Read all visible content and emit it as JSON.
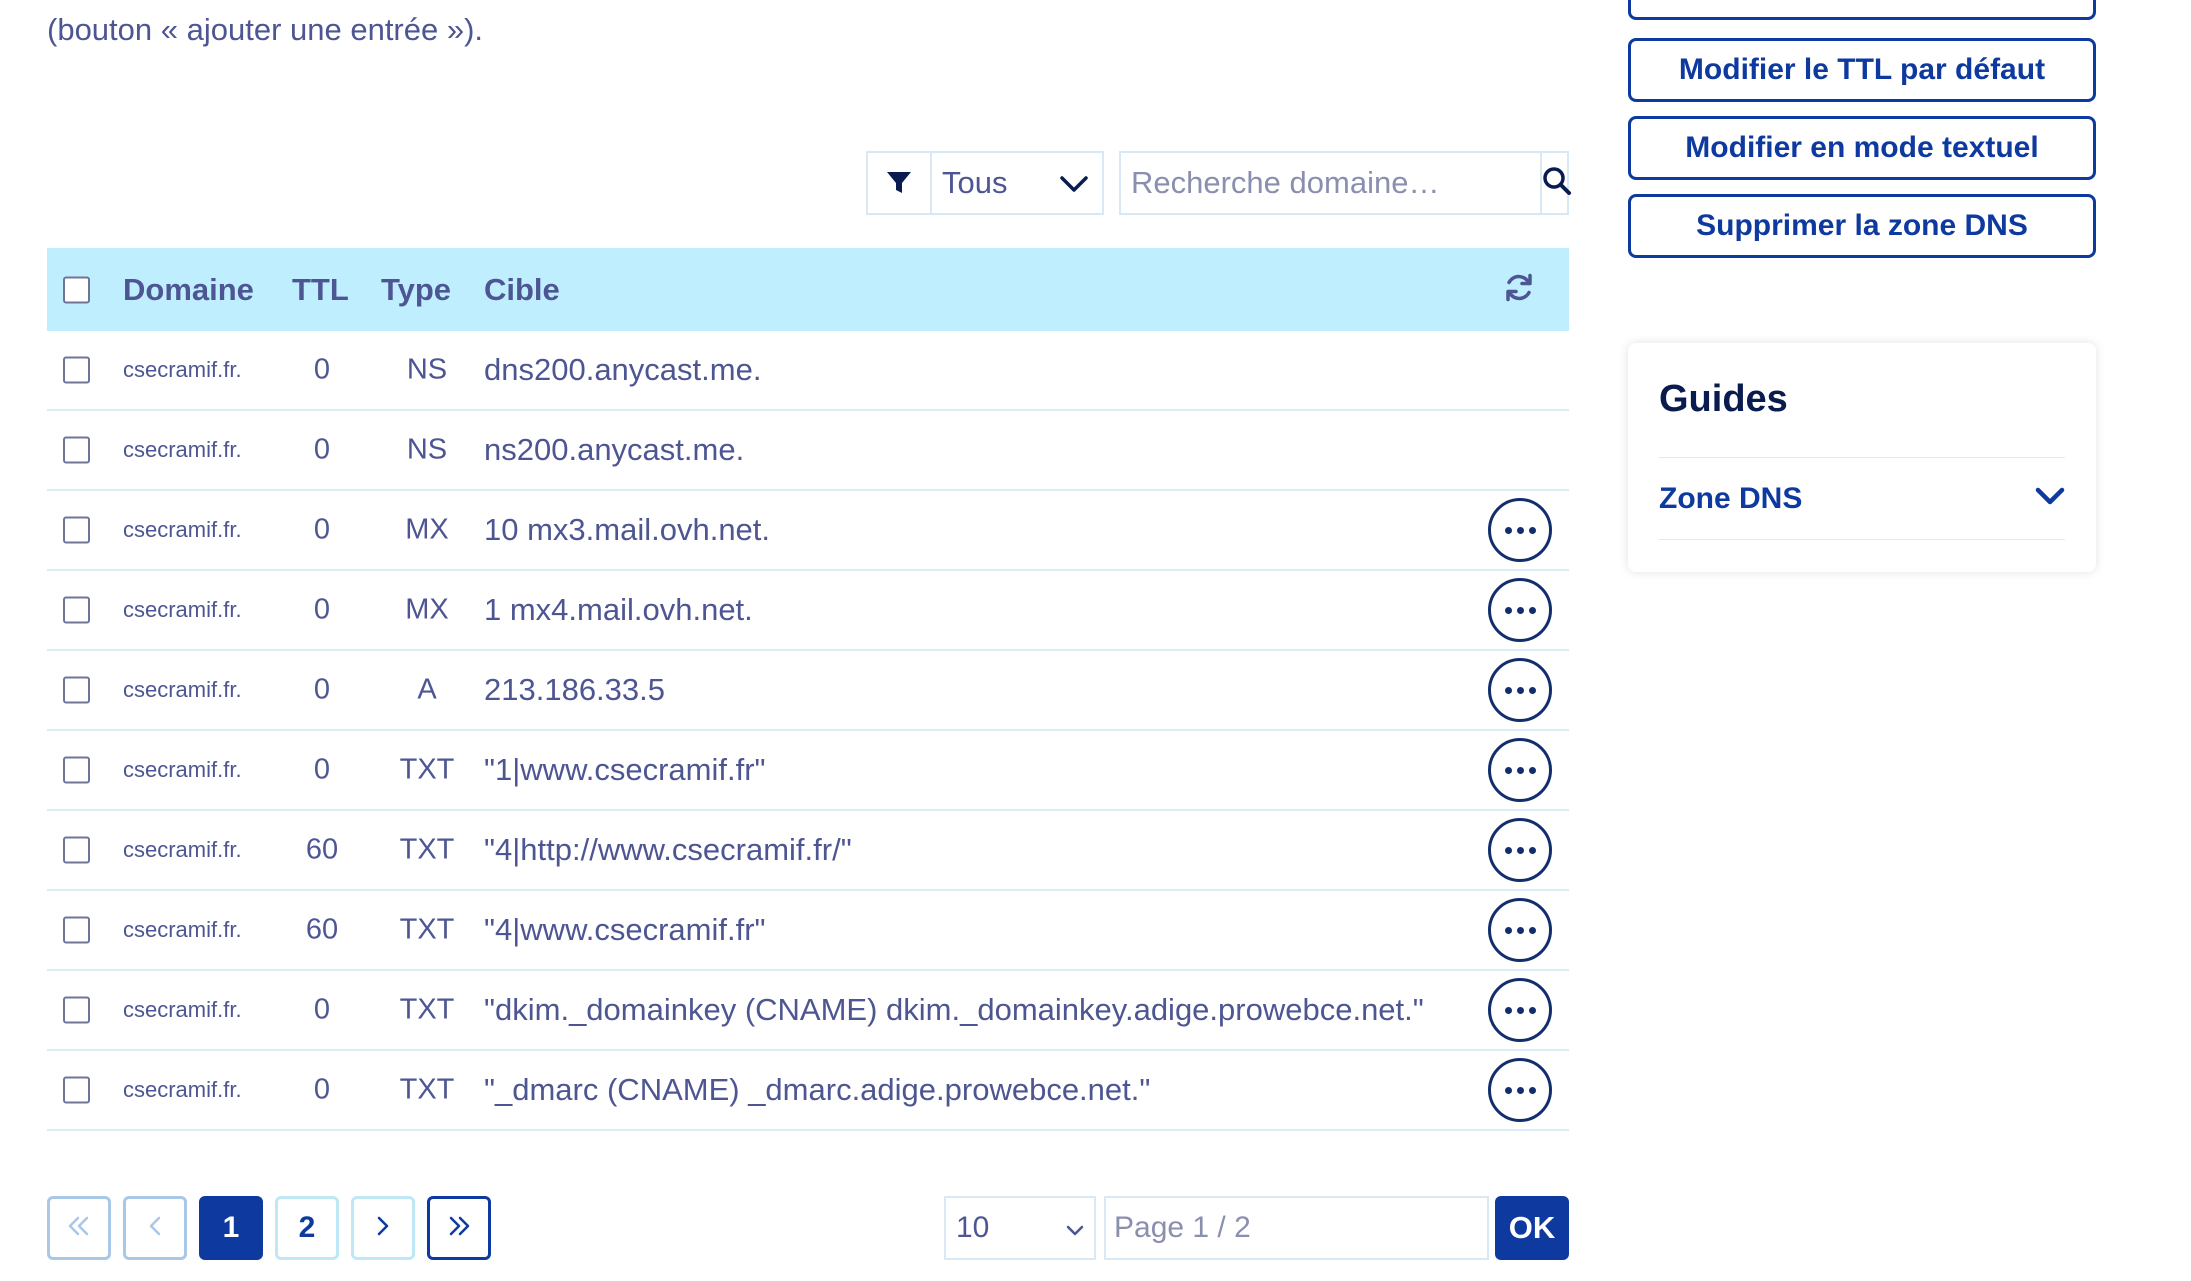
{
  "intro_text": "(bouton « ajouter une entrée »).",
  "filter": {
    "selected": "Tous"
  },
  "search": {
    "placeholder": "Recherche domaine…"
  },
  "table": {
    "headers": {
      "domain": "Domaine",
      "ttl": "TTL",
      "type": "Type",
      "target": "Cible"
    },
    "rows": [
      {
        "domain": "csecramif.fr.",
        "ttl": "0",
        "type": "NS",
        "target": "dns200.anycast.me.",
        "has_actions": false
      },
      {
        "domain": "csecramif.fr.",
        "ttl": "0",
        "type": "NS",
        "target": "ns200.anycast.me.",
        "has_actions": false
      },
      {
        "domain": "csecramif.fr.",
        "ttl": "0",
        "type": "MX",
        "target": "10 mx3.mail.ovh.net.",
        "has_actions": true
      },
      {
        "domain": "csecramif.fr.",
        "ttl": "0",
        "type": "MX",
        "target": "1 mx4.mail.ovh.net.",
        "has_actions": true
      },
      {
        "domain": "csecramif.fr.",
        "ttl": "0",
        "type": "A",
        "target": "213.186.33.5",
        "has_actions": true
      },
      {
        "domain": "csecramif.fr.",
        "ttl": "0",
        "type": "TXT",
        "target": "\"1|www.csecramif.fr\"",
        "has_actions": true
      },
      {
        "domain": "csecramif.fr.",
        "ttl": "60",
        "type": "TXT",
        "target": "\"4|http://www.csecramif.fr/\"",
        "has_actions": true
      },
      {
        "domain": "csecramif.fr.",
        "ttl": "60",
        "type": "TXT",
        "target": "\"4|www.csecramif.fr\"",
        "has_actions": true
      },
      {
        "domain": "csecramif.fr.",
        "ttl": "0",
        "type": "TXT",
        "target": "\"dkim._domainkey (CNAME) dkim._domainkey.adige.prowebce.net.\"",
        "has_actions": true
      },
      {
        "domain": "csecramif.fr.",
        "ttl": "0",
        "type": "TXT",
        "target": "\"_dmarc (CNAME) _dmarc.adige.prowebce.net.\"",
        "has_actions": true
      }
    ]
  },
  "sidebar": {
    "buttons": [
      {
        "label": "Modifier le TTL par défaut"
      },
      {
        "label": "Modifier en mode textuel"
      },
      {
        "label": "Supprimer la zone DNS"
      }
    ],
    "guides": {
      "title": "Guides",
      "item": "Zone DNS"
    }
  },
  "pagination": {
    "pages": [
      "1",
      "2"
    ],
    "current": "1",
    "page_size": "10",
    "page_input_placeholder": "Page 1 / 2",
    "ok_label": "OK"
  },
  "colors": {
    "primary": "#0e3aa0",
    "header_bg": "#bfeeff",
    "text": "#4d5693"
  }
}
